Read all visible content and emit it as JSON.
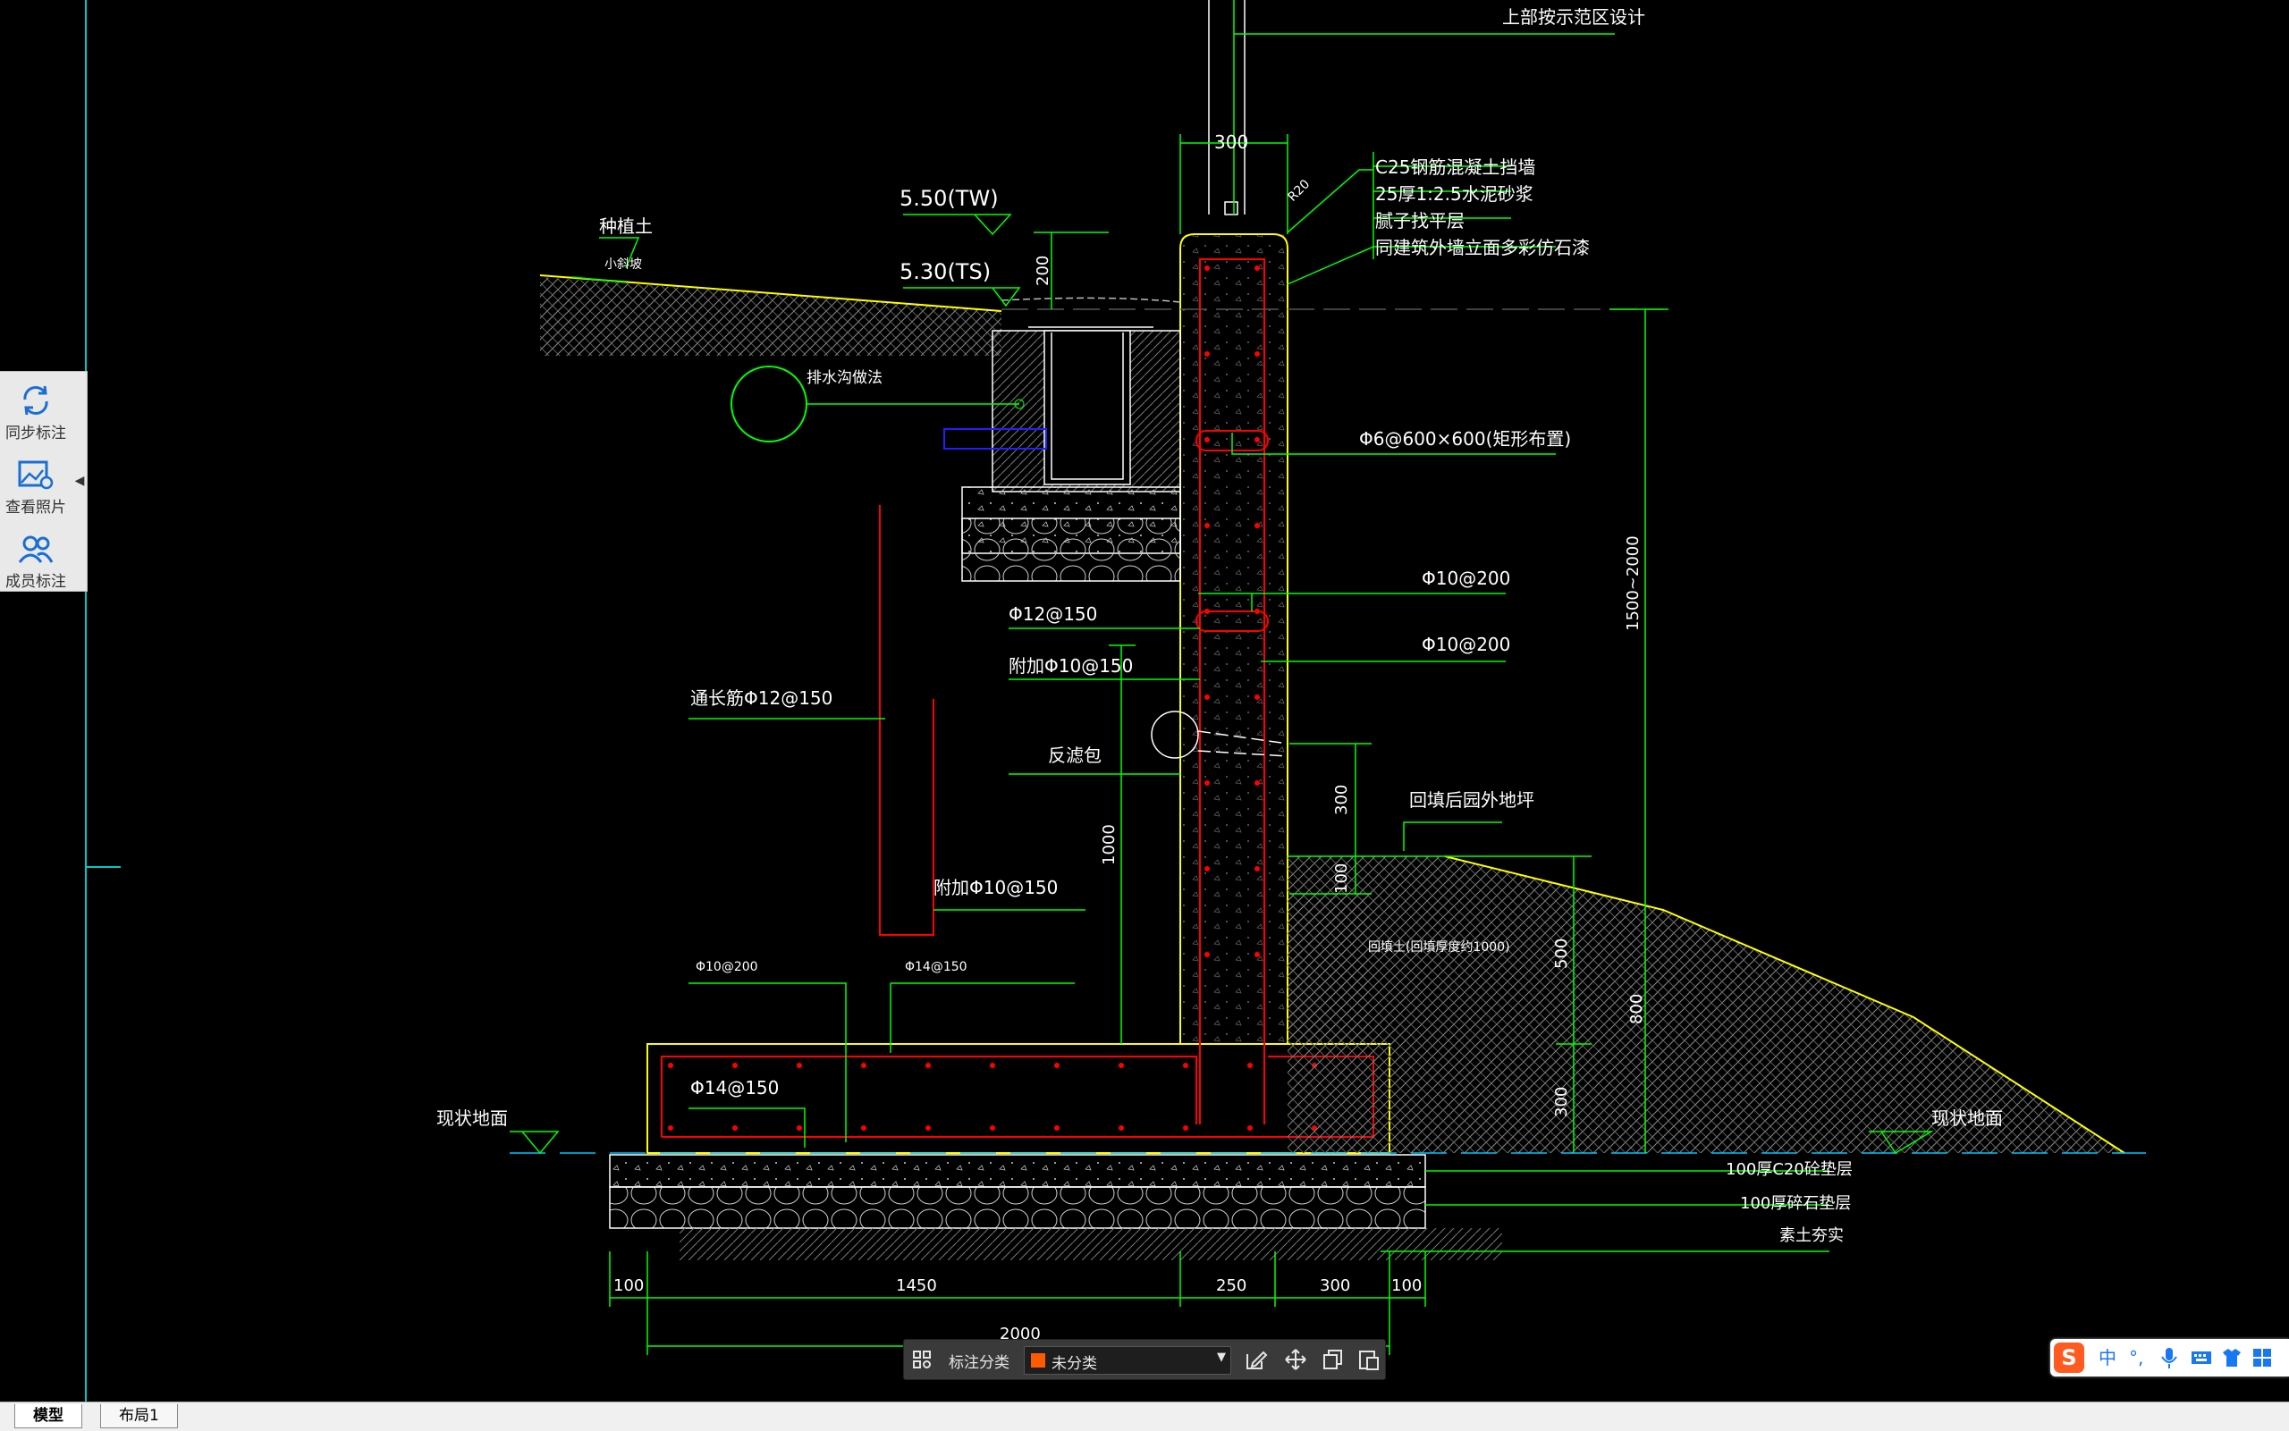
{
  "drawing": {
    "top_note": "上部按示范区设计",
    "wall_thickness": "300",
    "radius": "R20",
    "notes_right": [
      "C25钢筋混凝土挡墙",
      "25厚1:2.5水泥砂浆",
      "腻子找平层",
      "同建筑外墙立面多彩仿石漆"
    ],
    "elev_tw": "5.50(TW)",
    "elev_ts": "5.30(TS)",
    "planting_soil": "种植土",
    "small_slope": "小斜坡",
    "dim_200": "200",
    "drain_label": "排水沟做法",
    "rebar_phi6": "Φ6@600×600(矩形布置)",
    "rebar_phi10_a": "Φ10@200",
    "rebar_phi10_b": "Φ10@200",
    "rebar_phi12": "Φ12@150",
    "rebar_add10_a": "附加Φ10@150",
    "rebar_add10_b": "附加Φ10@150",
    "rebar_long12": "通长筋Φ12@150",
    "filter_pack": "反滤包",
    "backfill_label": "回填后园外地坪",
    "backfill_soil": "回填土(回填厚度约1000)",
    "dim_300_a": "300",
    "dim_100_a": "100",
    "dim_1000": "1000",
    "dim_500": "500",
    "dim_800": "800",
    "dim_300_b": "300",
    "dim_1500_2000": "1500~2000",
    "foot_phi10": "Φ10@200",
    "foot_phi14_a": "Φ14@150",
    "foot_phi14_b": "Φ14@150",
    "existing_ground_left": "现状地面",
    "existing_ground_right": "现状地面",
    "layer_c20": "100厚C20砼垫层",
    "layer_gravel": "100厚碎石垫层",
    "layer_soil": "素土夯实",
    "bottom_dims": [
      "100",
      "1450",
      "250",
      "300",
      "100"
    ],
    "total_dim": "2000"
  },
  "side_panel": {
    "items": [
      {
        "label": "同步标注",
        "icon": "sync-icon"
      },
      {
        "label": "查看照片",
        "icon": "photo-icon"
      },
      {
        "label": "成员标注",
        "icon": "members-icon"
      }
    ]
  },
  "annotation_bar": {
    "label": "标注分类",
    "selected": "未分类",
    "swatch_color": "#ff5a00"
  },
  "tabs": [
    {
      "label": "模型"
    },
    {
      "label": "布局1"
    }
  ],
  "ime": {
    "logo": "S",
    "mode": "中",
    "punct": "°,"
  },
  "colors": {
    "green": "#00ff00",
    "yellow": "#ffff00",
    "red": "#ff0000",
    "white": "#ffffff",
    "cyan": "#00c8c8",
    "blue": "#2020ff"
  }
}
